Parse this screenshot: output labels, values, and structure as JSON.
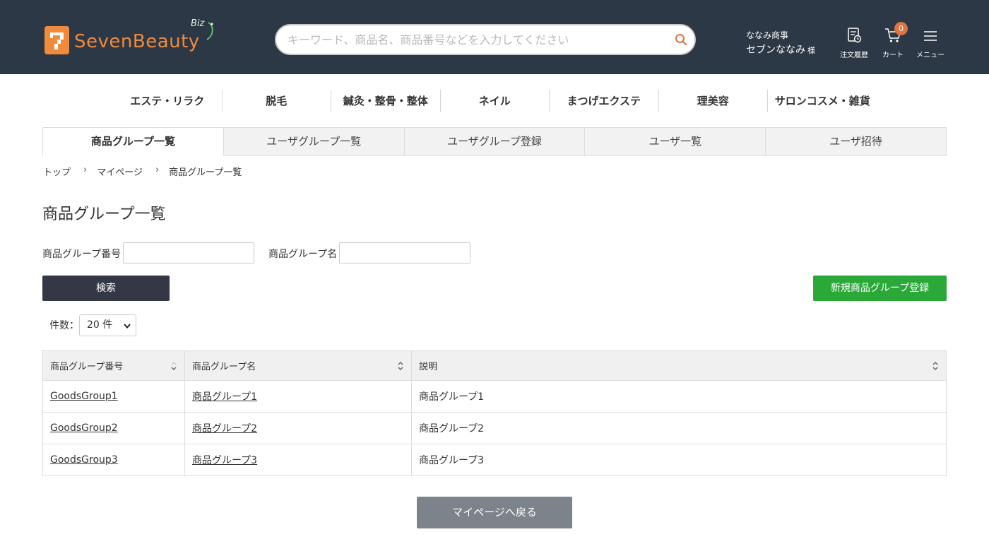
{
  "header": {
    "logo_text": "SevenBeauty",
    "logo_biz": "Biz",
    "search_placeholder": "キーワード、商品名、商品番号などを入力してください",
    "user_company": "ななみ商事",
    "user_name": "セブンななみ",
    "user_suffix": "様",
    "order_history_label": "注文履歴",
    "cart_label": "カート",
    "cart_count": "0",
    "menu_label": "メニュー"
  },
  "categories": [
    "エステ・リラク",
    "脱毛",
    "鍼灸・整骨・整体",
    "ネイル",
    "まつげエクステ",
    "理美容",
    "サロンコスメ・雑貨"
  ],
  "tabs": [
    "商品グループ一覧",
    "ユーザグループ一覧",
    "ユーザグループ登録",
    "ユーザ一覧",
    "ユーザ招待"
  ],
  "active_tab": 0,
  "breadcrumb": [
    "トップ",
    "マイページ",
    "商品グループ一覧"
  ],
  "page_title": "商品グループ一覧",
  "filters": {
    "group_number_label": "商品グループ番号",
    "group_number_value": "",
    "group_name_label": "商品グループ名",
    "group_name_value": ""
  },
  "buttons": {
    "search": "検索",
    "new_group": "新規商品グループ登録",
    "back": "マイページへ戻る"
  },
  "count": {
    "label": "件数：",
    "selected": "20 件"
  },
  "table": {
    "headers": [
      "商品グループ番号",
      "商品グループ名",
      "説明"
    ],
    "rows": [
      [
        "GoodsGroup1",
        "商品グループ1",
        "商品グループ1"
      ],
      [
        "GoodsGroup2",
        "商品グループ2",
        "商品グループ2"
      ],
      [
        "GoodsGroup3",
        "商品グループ3",
        "商品グループ3"
      ]
    ]
  },
  "colors": {
    "header_bg": "#2c3845",
    "brand_orange": "#f08a3c",
    "search_button": "#343846",
    "new_button": "#2aa838",
    "back_button": "#7d838b",
    "cart_badge": "#e07440"
  }
}
